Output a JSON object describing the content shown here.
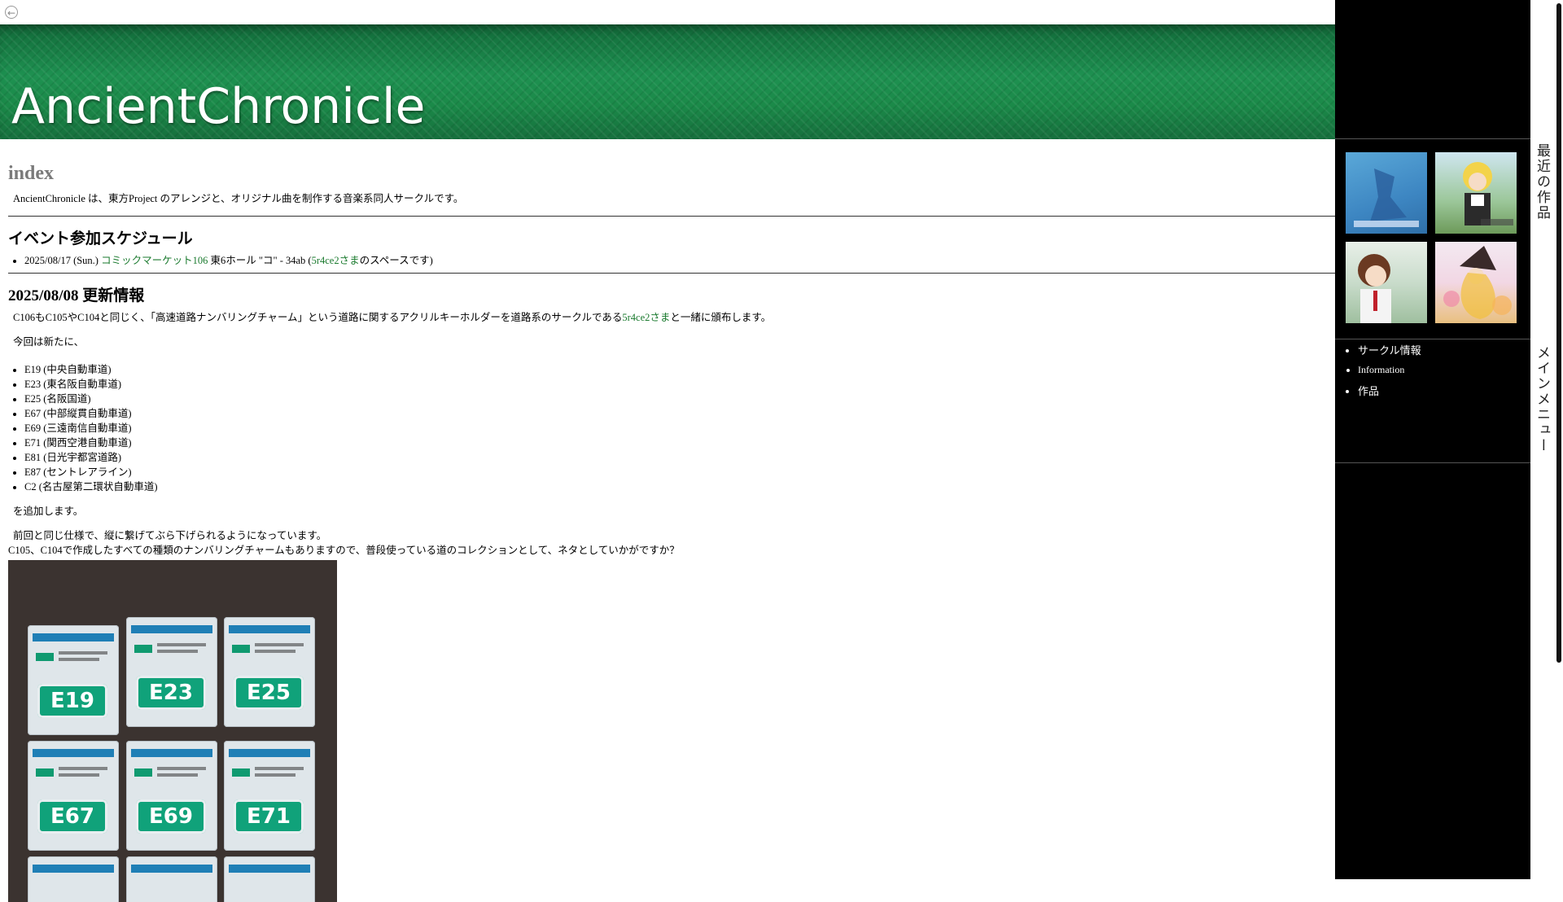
{
  "banner": {
    "title": "AncientChronicle"
  },
  "main": {
    "page_title": "index",
    "intro": "AncientChronicle は、東方Project のアレンジと、オリジナル曲を制作する音楽系同人サークルです。",
    "events": {
      "heading": "イベント参加スケジュール",
      "item": {
        "date": "2025/08/17 (Sun.)",
        "event_link": "コミックマーケット106",
        "location": "東6ホール \"コ\" - 34ab (",
        "circle_link": "5r4ce2さま",
        "suffix": "のスペースです)"
      }
    },
    "update": {
      "heading": "2025/08/08 更新情報",
      "p1_before": "C106もC105やC104と同じく、「高速道路ナンバリングチャーム」という道路に関するアクリルキーホルダーを道路系のサークルである",
      "p1_link": "5r4ce2さま",
      "p1_after": "と一緒に頒布します。",
      "p2": "今回は新たに、",
      "roads": [
        "E19 (中央自動車道)",
        "E23 (東名阪自動車道)",
        "E25 (名阪国道)",
        "E67 (中部縦貫自動車道)",
        "E69 (三遠南信自動車道)",
        "E71 (関西空港自動車道)",
        "E81 (日光宇都宮道路)",
        "E87 (セントレアライン)",
        "C2 (名古屋第二環状自動車道)"
      ],
      "p3": "を追加します。",
      "p4": "前回と同じ仕様で、縦に繋げてぶら下げられるようになっています。",
      "p5": "C105、C104で作成したすべての種類のナンバリングチャームもありますので、普段使っている道のコレクションとして、ネタとしていかがですか？",
      "photo_tags": [
        "E19",
        "E23",
        "E25",
        "E67",
        "E69",
        "E71"
      ]
    }
  },
  "sidebar": {
    "recent_tab": "最近の作品",
    "menu_tab": "メインメニュー",
    "menu": [
      "サークル情報",
      "Information",
      "作品"
    ]
  },
  "colors": {
    "accent_green": "#1a7a2e",
    "banner_green": "#1e9151",
    "sidebar_bg": "#000000"
  }
}
